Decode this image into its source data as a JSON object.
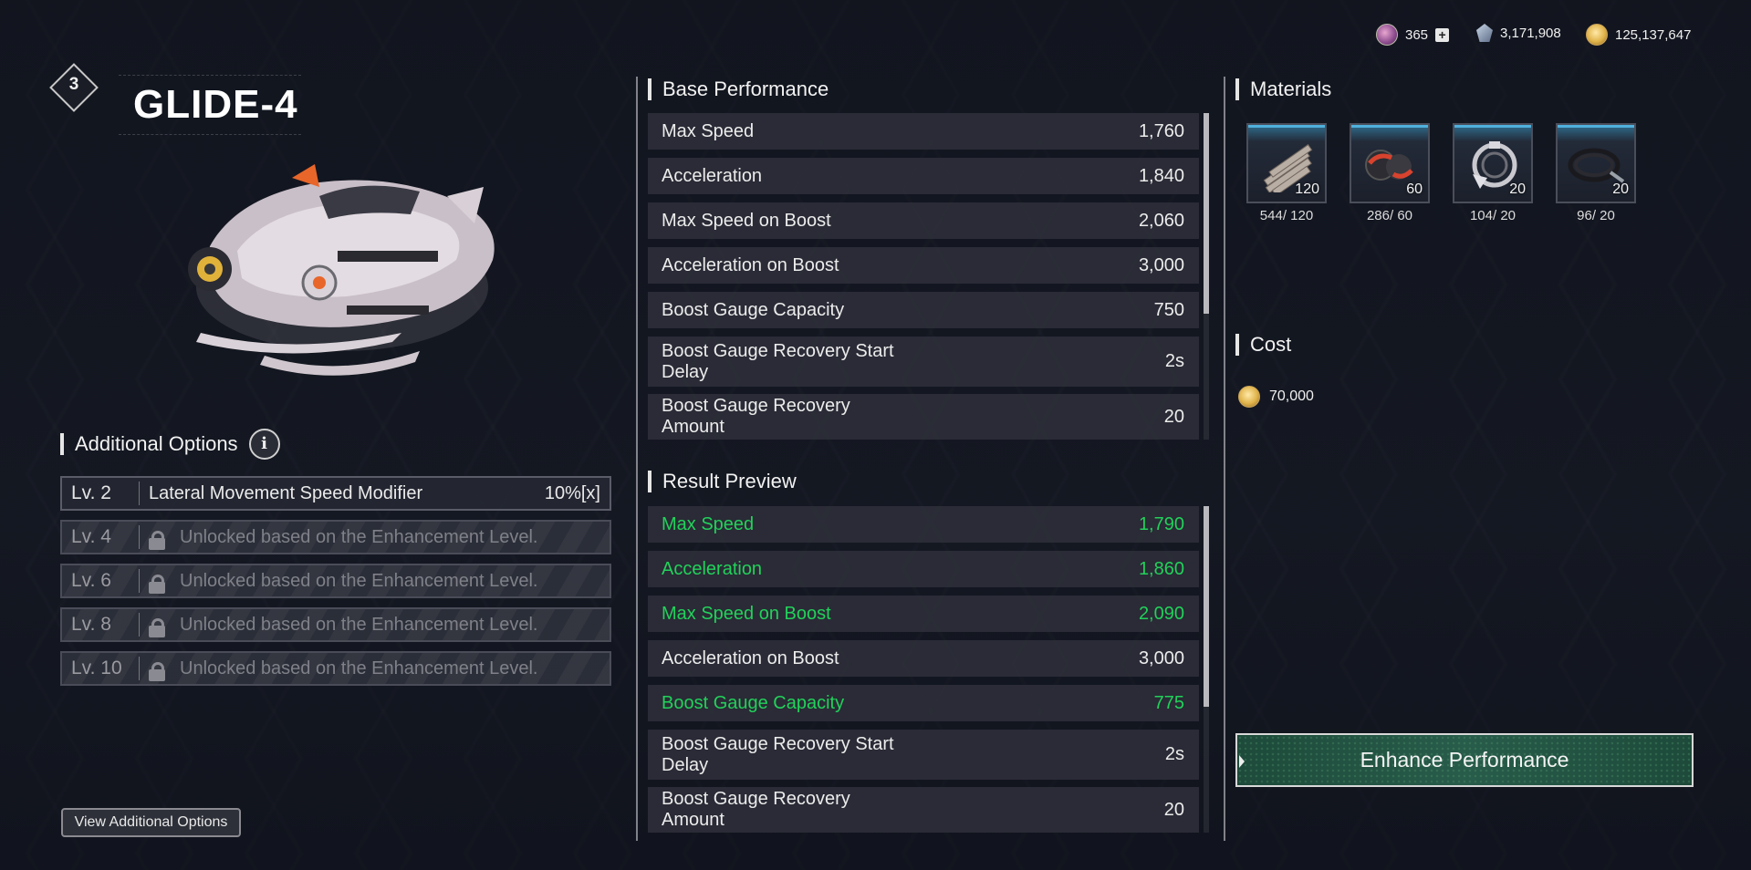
{
  "currencies": [
    {
      "icon": "gem-icon",
      "value": "365"
    },
    {
      "icon": "crystal-icon",
      "value": "3,171,908"
    },
    {
      "icon": "gold-coin-icon",
      "value": "125,137,647"
    }
  ],
  "vehicle": {
    "level": "3",
    "name": "GLIDE-4"
  },
  "additional_options": {
    "title": "Additional Options",
    "rows": [
      {
        "level": "Lv. 2",
        "text": "Lateral Movement Speed Modifier",
        "value": "10%[x]",
        "locked": false
      },
      {
        "level": "Lv. 4",
        "text": "Unlocked based on the Enhancement Level.",
        "locked": true
      },
      {
        "level": "Lv. 6",
        "text": "Unlocked based on the Enhancement Level.",
        "locked": true
      },
      {
        "level": "Lv. 8",
        "text": "Unlocked based on the Enhancement Level.",
        "locked": true
      },
      {
        "level": "Lv. 10",
        "text": "Unlocked based on the Enhancement Level.",
        "locked": true
      }
    ],
    "view_button": "View Additional Options"
  },
  "base_performance": {
    "title": "Base Performance",
    "rows": [
      {
        "name": "Max Speed",
        "value": "1,760"
      },
      {
        "name": "Acceleration",
        "value": "1,840"
      },
      {
        "name": "Max Speed on Boost",
        "value": "2,060"
      },
      {
        "name": "Acceleration on Boost",
        "value": "3,000"
      },
      {
        "name": "Boost Gauge Capacity",
        "value": "750"
      },
      {
        "name": "Boost Gauge Recovery Start Delay",
        "value": "2s"
      },
      {
        "name": "Boost Gauge Recovery Amount",
        "value": "20"
      }
    ]
  },
  "result_preview": {
    "title": "Result Preview",
    "rows": [
      {
        "name": "Max Speed",
        "value": "1,790",
        "changed": true
      },
      {
        "name": "Acceleration",
        "value": "1,860",
        "changed": true
      },
      {
        "name": "Max Speed on Boost",
        "value": "2,090",
        "changed": true
      },
      {
        "name": "Acceleration on Boost",
        "value": "3,000",
        "changed": false
      },
      {
        "name": "Boost Gauge Capacity",
        "value": "775",
        "changed": true
      },
      {
        "name": "Boost Gauge Recovery Start Delay",
        "value": "2s",
        "changed": false
      },
      {
        "name": "Boost Gauge Recovery Amount",
        "value": "20",
        "changed": false
      }
    ]
  },
  "materials": {
    "title": "Materials",
    "items": [
      {
        "icon": "metal-rods-icon",
        "required": "120",
        "owned": "544/ 120"
      },
      {
        "icon": "engine-part-icon",
        "required": "60",
        "owned": "286/ 60"
      },
      {
        "icon": "clamp-ring-icon",
        "required": "20",
        "owned": "104/ 20"
      },
      {
        "icon": "cable-icon",
        "required": "20",
        "owned": "96/ 20"
      }
    ]
  },
  "cost": {
    "title": "Cost",
    "icon": "gold-coin-icon",
    "value": "70,000"
  },
  "enhance_button": "Enhance Performance",
  "colors": {
    "changed_stat": "#22d15a",
    "button_fill": "#285c4a",
    "material_accent": "#4fb0dc"
  }
}
